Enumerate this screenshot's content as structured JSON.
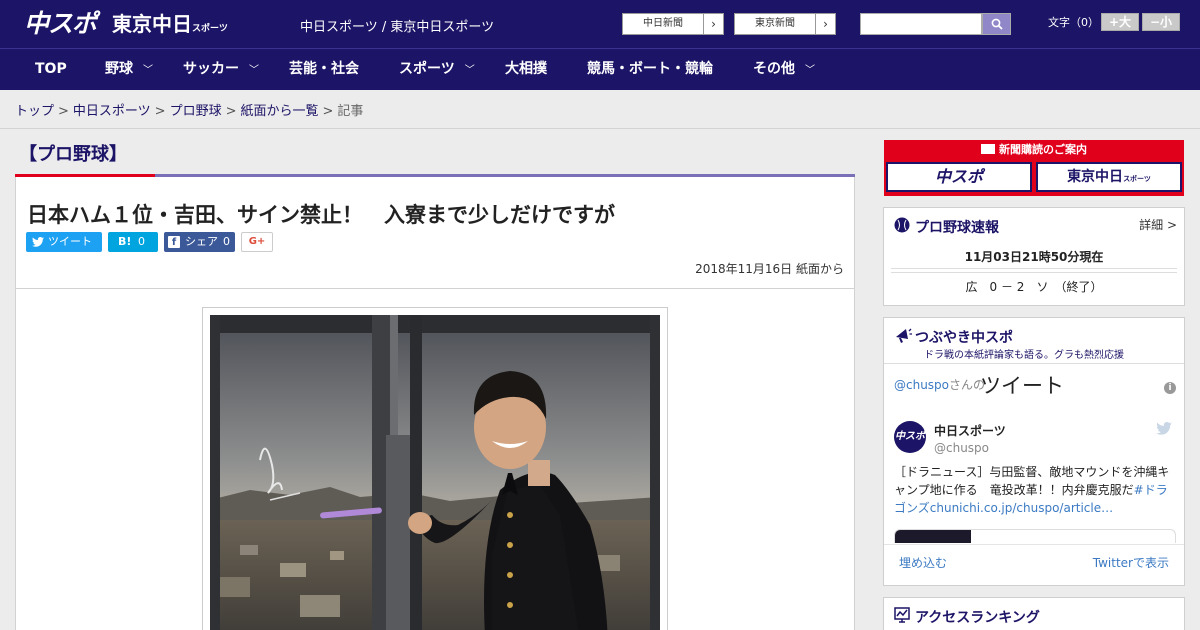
{
  "header": {
    "logo_chuspo": "中スポ",
    "logo_tokyo": "東京中日",
    "logo_tokyo_sub": "スポーツ",
    "site_title": "中日スポーツ / 東京中日スポーツ",
    "ext_links": [
      {
        "label": "中日新聞",
        "arrow": "›"
      },
      {
        "label": "東京新聞",
        "arrow": "›"
      }
    ],
    "search_placeholder": "",
    "fontsize_label": "文字（0）",
    "fontsize_larger": "+大",
    "fontsize_smaller": "−小"
  },
  "nav": {
    "items": [
      {
        "label": "TOP"
      },
      {
        "label": "野球",
        "chevron": "﹀"
      },
      {
        "label": "サッカー",
        "chevron": "﹀"
      },
      {
        "label": "芸能・社会"
      },
      {
        "label": "スポーツ",
        "chevron": "﹀"
      },
      {
        "label": "大相撲"
      },
      {
        "label": "競馬・ボート・競輪"
      },
      {
        "label": "その他",
        "chevron": "﹀"
      }
    ]
  },
  "breadcrumb": {
    "items": [
      "トップ",
      "中日スポーツ",
      "プロ野球",
      "紙面から一覧"
    ],
    "separator": ">",
    "current": "記事"
  },
  "article": {
    "category": "【プロ野球】",
    "headline": "日本ハム１位・吉田、サイン禁止！　入寮まで少しだけですが",
    "share": {
      "tweet": "ツイート",
      "hatena_label": "B!",
      "hatena_count": "0",
      "fb_label": "シェア",
      "fb_count": "0",
      "gplus": "G+"
    },
    "date": "2018年11月16日 紙面から"
  },
  "sidebar": {
    "ad": {
      "heading": "新聞購読のご案内",
      "logo_left": "中スポ",
      "logo_right": "東京中日",
      "logo_right_sub": "スポーツ"
    },
    "baseball": {
      "title": "プロ野球速報",
      "more": "詳細 >",
      "time": "11月03日21時50分現在",
      "score": "広　0 － 2　ソ　（終了）"
    },
    "twitter": {
      "title": "つぶやき中スポ",
      "subtitle": "ドラ戦の本紙評論家も語る。グラも熱烈応援",
      "handle": "@chuspo",
      "handle_suffix": "さんの",
      "tweet_word": "ツイート",
      "info": "i",
      "avatar_text": "中スポ",
      "name": "中日スポーツ",
      "at": "@chuspo",
      "text_main": "［ドラニュース］与田監督、敵地マウンドを沖縄キャンプ地に作る　竜投改革！！内弁慶克服だ",
      "text_link": "#ドラゴンズchunichi.co.jp/chuspo/article…",
      "embed": "埋め込む",
      "view": "Twitterで表示"
    },
    "ranking": {
      "title": "アクセスランキング"
    }
  }
}
